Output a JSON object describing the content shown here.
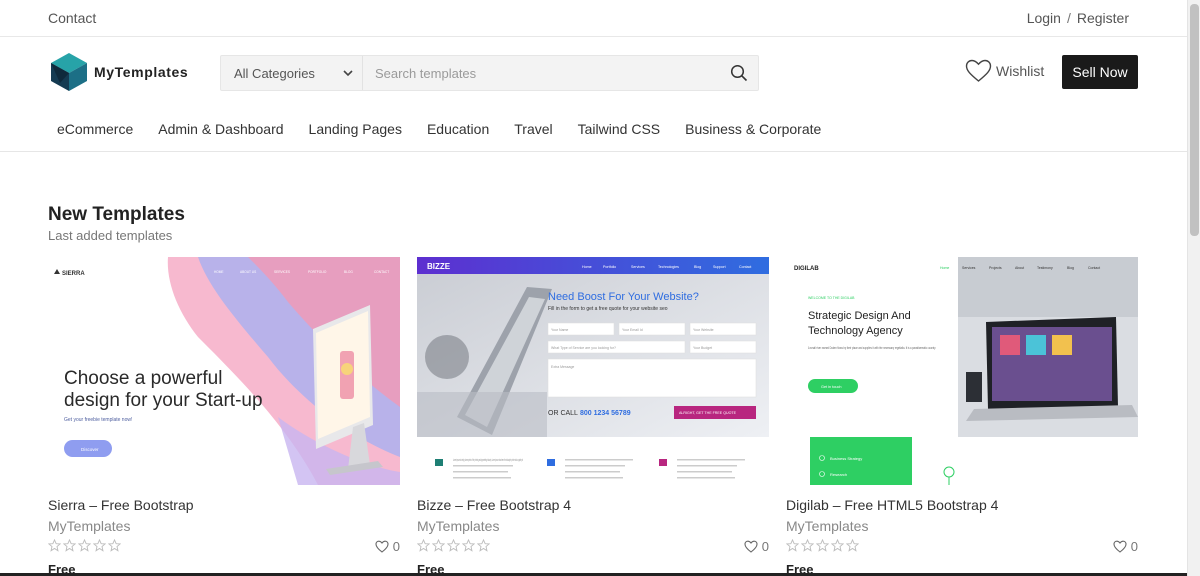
{
  "topbar": {
    "contact": "Contact",
    "login": "Login",
    "separator": "/",
    "register": "Register"
  },
  "header": {
    "logo_text": "MyTemplates",
    "search": {
      "category": "All Categories",
      "placeholder": "Search templates"
    },
    "wishlist": "Wishlist",
    "sell": "Sell Now"
  },
  "categories": [
    "eCommerce",
    "Admin & Dashboard",
    "Landing Pages",
    "Education",
    "Travel",
    "Tailwind CSS",
    "Business & Corporate"
  ],
  "section": {
    "title": "New Templates",
    "subtitle": "Last added templates"
  },
  "cards": [
    {
      "title": "Sierra – Free Bootstrap",
      "author": "MyTemplates",
      "likes": "0",
      "price": "Free",
      "preview": {
        "brand": "SIERRA",
        "nav": [
          "HOME",
          "ABOUT US",
          "SERVICES",
          "PORTFOLIO",
          "BLOG",
          "CONTACT"
        ],
        "headline1": "Choose a powerful",
        "headline2": "design for your Start-up",
        "tagline": "Get your freebie template now!",
        "button": "Discover"
      }
    },
    {
      "title": "Bizze – Free Bootstrap 4",
      "author": "MyTemplates",
      "likes": "0",
      "price": "Free",
      "preview": {
        "brand": "BIZZE",
        "nav": [
          "Home",
          "Portfolio",
          "Services",
          "Technologies",
          "Blog",
          "Support",
          "Contact"
        ],
        "headline": "Need Boost For Your Website?",
        "sub": "Fill in the form to get a free quote for your website seo",
        "fields": [
          "Your Name",
          "Your Email Id",
          "Your Website",
          "What Type of Service are you looking for?",
          "Your Budget",
          "Extra Message"
        ],
        "call": "OR CALL",
        "phone": "800 1234 56789",
        "cta": "ALRIGHT, GET THE FREE QUOTE",
        "blurb": "Lorem ipsum is simply dummy text of the printing and typesetting industry. Lorem ipsum has been the industry's printer took a galley of"
      }
    },
    {
      "title": "Digilab – Free HTML5 Bootstrap 4",
      "author": "MyTemplates",
      "likes": "0",
      "price": "Free",
      "preview": {
        "brand": "DIGILAB",
        "nav": [
          "Home",
          "Services",
          "Projects",
          "About",
          "Testimony",
          "Blog",
          "Contact"
        ],
        "kicker": "WELCOME TO THE DIGILAB",
        "headline1": "Strategic Design And",
        "headline2": "Technology Agency",
        "desc": "A small river named Duden flows by their place and supplies it with the necessary regelialia. It is a paradisematic country.",
        "button": "Get in touch",
        "items": [
          "Business Strategy",
          "Research"
        ]
      }
    }
  ],
  "colors": {
    "accent_dark": "#1a1a1a",
    "bizze_blue": "#2f6de0",
    "bizze_magenta": "#b8267f",
    "digilab_green": "#2ecf63",
    "logo_teal": "#1c8a9c"
  }
}
